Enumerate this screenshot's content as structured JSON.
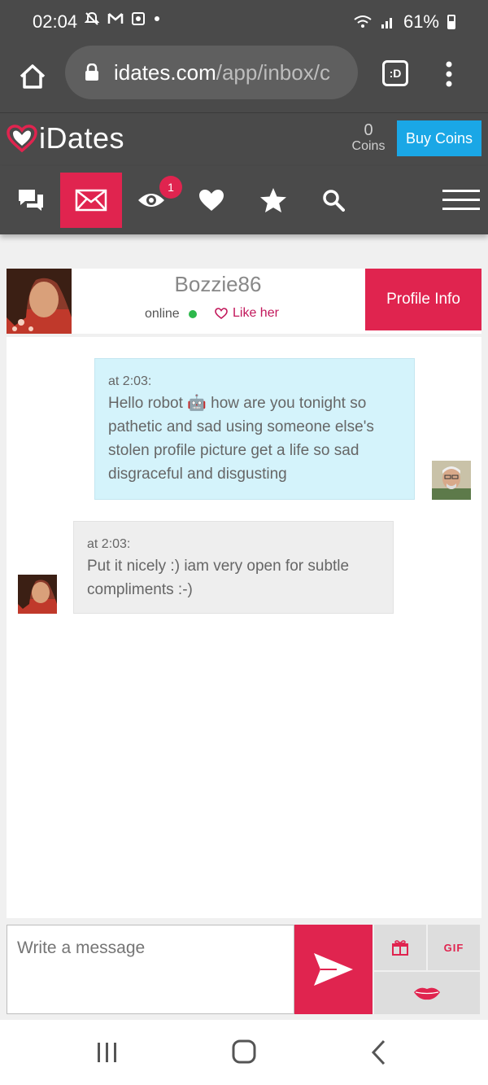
{
  "status_bar": {
    "time": "02:04",
    "battery": "61%",
    "icons": [
      "mute-icon",
      "gmail-icon",
      "app-icon",
      "dot-icon",
      "wifi-icon",
      "signal-icon",
      "battery-icon"
    ]
  },
  "browser": {
    "url_domain": "idates.com",
    "url_path": "/app/inbox/c",
    "tabs_label": ":D"
  },
  "site": {
    "logo_text": "iDates",
    "coins_count": "0",
    "coins_label": "Coins",
    "buy_coins_label": "Buy Coins"
  },
  "nav": {
    "badge_count": "1",
    "items": [
      "chat-icon",
      "mail-icon",
      "eye-icon",
      "heart-icon",
      "star-icon",
      "search-icon",
      "hamburger-menu-icon"
    ],
    "active": "mail-icon"
  },
  "conversation": {
    "username": "Bozzie86",
    "status": "online",
    "like_label": "Like her",
    "profile_info_label": "Profile Info"
  },
  "messages": [
    {
      "direction": "outgoing",
      "time": "at 2:03:",
      "text_before_emoji": "Hello robot ",
      "emoji": "🤖",
      "text_after_emoji": " how are you tonight so pathetic and sad using someone else's stolen profile picture get a life so sad disgraceful and disgusting"
    },
    {
      "direction": "incoming",
      "time": "at 2:03:",
      "text": "Put it nicely :) iam very open for subtle compliments :-)"
    }
  ],
  "compose": {
    "placeholder": "Write a message",
    "gif_label": "GIF"
  },
  "colors": {
    "brand_red": "#e0244f",
    "buy_blue": "#1aa7e6",
    "header_gray": "#4a4a4a",
    "outgoing_bubble": "#d4f3fb",
    "incoming_bubble": "#eeeeee",
    "online_green": "#2db84b"
  }
}
